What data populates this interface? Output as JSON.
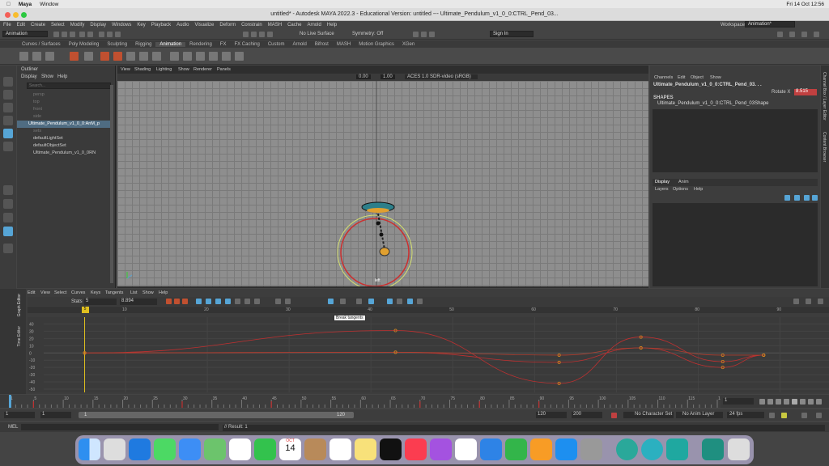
{
  "mac_menubar": {
    "app": "Maya",
    "items": [
      "Window"
    ],
    "clock": "Fri 14 Oct 12:56"
  },
  "window_title": "untitled* - Autodesk MAYA 2022.3 - Educational Version: untitled  ---  Ultimate_Pendulum_v1_0_0:CTRL_Pend_03...",
  "menus": [
    "File",
    "Edit",
    "Create",
    "Select",
    "Modify",
    "Display",
    "Windows",
    "Key",
    "Playback",
    "Audio",
    "Visualize",
    "Deform",
    "Constrain",
    "MASH",
    "Cache",
    "Arnold",
    "Help"
  ],
  "workspace": {
    "label": "Workspace :",
    "value": "Animation*"
  },
  "status_line": {
    "mode": "Animation",
    "live_surface": "No Live Surface",
    "symmetry": "Symmetry: Off",
    "sign_in": "Sign In"
  },
  "shelf_tabs": [
    "Curves / Surfaces",
    "Poly Modeling",
    "Sculpting",
    "Rigging",
    "Animation",
    "Rendering",
    "FX",
    "FX Caching",
    "Custom",
    "Arnold",
    "Bifrost",
    "MASH",
    "Motion Graphics",
    "XGen"
  ],
  "active_shelf_tab": "Animation",
  "outliner": {
    "title": "Outliner",
    "menus": [
      "Display",
      "Show",
      "Help"
    ],
    "search_placeholder": "Search...",
    "items": [
      "persp",
      "top",
      "front",
      "side",
      "Ultimate_Pendulum_v1_0_0:AnM_p",
      "sets",
      "defaultLightSet",
      "defaultObjectSet",
      "Ultimate_Pendulum_v1_0_0RN"
    ]
  },
  "viewport": {
    "menus": [
      "View",
      "Shading",
      "Lighting",
      "Show",
      "Renderer",
      "Panels"
    ],
    "exposure": "0.00",
    "gamma": "1.00",
    "colorspace": "ACES 1.0 SDR-video (sRGB)",
    "axis_label": "left"
  },
  "channel_box": {
    "menus": [
      "Channels",
      "Edit",
      "Object",
      "Show"
    ],
    "object": "Ultimate_Pendulum_v1_0_0:CTRL_Pend_03. . .",
    "attr_label": "Rotate X",
    "attr_value": "8.515",
    "shapes_header": "SHAPES",
    "shape_name": "Ultimate_Pendulum_v1_0_0:CTRL_Pend_03Shape"
  },
  "layer_editor": {
    "tabs": [
      "Display",
      "Anim"
    ],
    "menus": [
      "Layers",
      "Options",
      "Help"
    ]
  },
  "side_tabs": [
    "Channel Box / Layer Editor",
    "Content Browser"
  ],
  "graph_editor": {
    "side_tabs": [
      "Graph Editor",
      "Time Editor"
    ],
    "menus": [
      "Edit",
      "View",
      "Select",
      "Curves",
      "Keys",
      "Tangents",
      "List",
      "Show",
      "Help"
    ],
    "stats_label": "Stats",
    "frame_value": "5",
    "value_field": "8.894",
    "tooltip": "Break tangents",
    "x_ticks": [
      "10",
      "20",
      "30",
      "40",
      "50",
      "60",
      "70",
      "80",
      "90"
    ],
    "y_ticks": [
      "40",
      "30",
      "20",
      "10",
      "0",
      "-10",
      "-20",
      "-30",
      "-40",
      "-50"
    ],
    "current_frame_marker": "5"
  },
  "time_slider": {
    "ticks": [
      "1",
      "5",
      "10",
      "15",
      "20",
      "25",
      "30",
      "35",
      "40",
      "45",
      "50",
      "55",
      "60",
      "65",
      "70",
      "75",
      "80",
      "85",
      "90",
      "95",
      "100",
      "105",
      "110",
      "115",
      "120"
    ],
    "current_frame": "1"
  },
  "range_bar": {
    "start": "1",
    "playback_start": "1",
    "slider_start": "1",
    "slider_end": "120",
    "playback_end": "120",
    "end": "200",
    "character_set": "No Character Set",
    "anim_layer": "No Anim Layer",
    "fps": "24 fps"
  },
  "command_line": {
    "lang": "MEL",
    "result": "// Result: 1"
  },
  "dock": {
    "calendar_month": "OCT",
    "calendar_day": "14"
  },
  "chart_data": {
    "type": "line",
    "xlabel": "",
    "ylabel": "",
    "xlim": [
      0,
      95
    ],
    "ylim": [
      -50,
      45
    ],
    "series": [
      {
        "x": [
          5,
          43,
          63,
          73,
          83,
          88
        ],
        "y": [
          0,
          31,
          -42,
          22,
          -12,
          -3
        ]
      },
      {
        "x": [
          5,
          43,
          63,
          73,
          83,
          88
        ],
        "y": [
          0,
          1,
          -13,
          7,
          -20,
          -3
        ]
      },
      {
        "x": [
          5,
          43,
          63,
          73,
          83,
          88
        ],
        "y": [
          0,
          1,
          -3,
          7,
          -3,
          -3
        ]
      }
    ]
  },
  "colors": {
    "accent": "#56a5d6",
    "playhead": "#e0c020",
    "curve_red": "#c03030",
    "curve_orange": "#d08020"
  }
}
